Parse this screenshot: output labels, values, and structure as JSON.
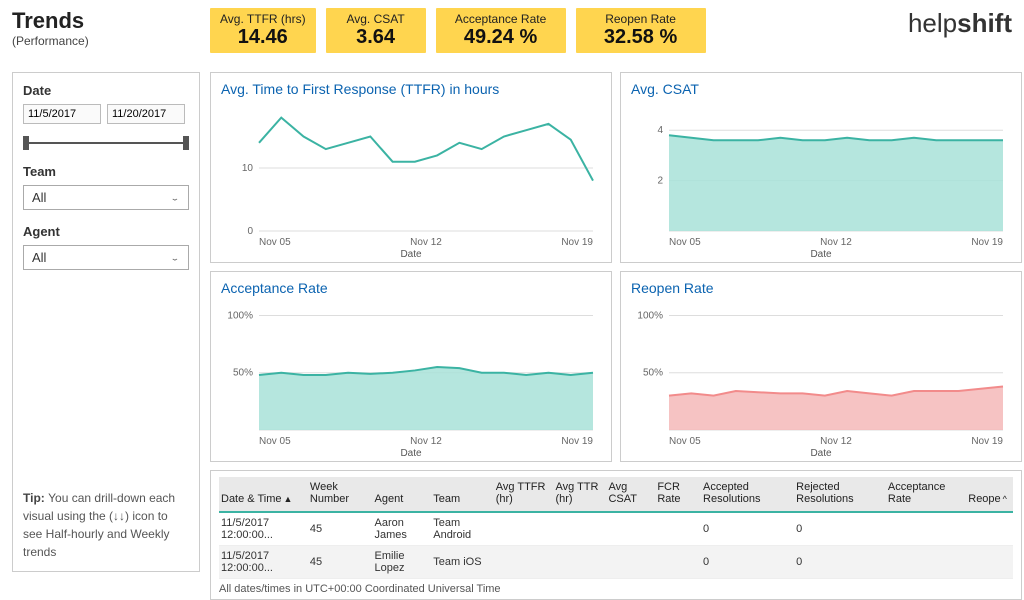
{
  "header": {
    "title": "Trends",
    "subtitle": "(Performance)",
    "brand_a": "help",
    "brand_b": "shift"
  },
  "kpis": [
    {
      "label": "Avg. TTFR (hrs)",
      "value": "14.46"
    },
    {
      "label": "Avg. CSAT",
      "value": "3.64"
    },
    {
      "label": "Acceptance Rate",
      "value": "49.24 %"
    },
    {
      "label": "Reopen Rate",
      "value": "32.58 %"
    }
  ],
  "sidebar": {
    "date_label": "Date",
    "date_from": "11/5/2017",
    "date_to": "11/20/2017",
    "team_label": "Team",
    "team_value": "All",
    "agent_label": "Agent",
    "agent_value": "All",
    "tip_label": "Tip:",
    "tip_text": "You can drill-down each visual using the (↓↓) icon to see Half-hourly and Weekly trends"
  },
  "chart_titles": {
    "ttfr": "Avg. Time to First Response (TTFR) in hours",
    "csat": "Avg. CSAT",
    "acc": "Acceptance Rate",
    "reopen": "Reopen Rate",
    "xaxis": "Date"
  },
  "xticks": {
    "first": "Nov 05",
    "mid": "Nov 12",
    "last": "Nov 19"
  },
  "chart_data": [
    {
      "id": "ttfr",
      "type": "line",
      "title": "Avg. Time to First Response (TTFR) in hours",
      "xlabel": "Date",
      "ylabel": "",
      "ylim": [
        0,
        20
      ],
      "yticks": [
        0,
        10
      ],
      "categories": [
        "Nov 05",
        "Nov 06",
        "Nov 07",
        "Nov 08",
        "Nov 09",
        "Nov 10",
        "Nov 11",
        "Nov 12",
        "Nov 13",
        "Nov 14",
        "Nov 15",
        "Nov 16",
        "Nov 17",
        "Nov 18",
        "Nov 19",
        "Nov 20"
      ],
      "values": [
        14,
        18,
        15,
        13,
        14,
        15,
        11,
        11,
        12,
        14,
        13,
        15,
        16,
        17,
        14.5,
        8
      ],
      "color": "#3bb3a3",
      "fill": false
    },
    {
      "id": "csat",
      "type": "area",
      "title": "Avg. CSAT",
      "xlabel": "Date",
      "ylabel": "",
      "ylim": [
        0,
        5
      ],
      "yticks": [
        2,
        4
      ],
      "categories": [
        "Nov 05",
        "Nov 06",
        "Nov 07",
        "Nov 08",
        "Nov 09",
        "Nov 10",
        "Nov 11",
        "Nov 12",
        "Nov 13",
        "Nov 14",
        "Nov 15",
        "Nov 16",
        "Nov 17",
        "Nov 18",
        "Nov 19",
        "Nov 20"
      ],
      "values": [
        3.8,
        3.7,
        3.6,
        3.6,
        3.6,
        3.7,
        3.6,
        3.6,
        3.7,
        3.6,
        3.6,
        3.7,
        3.6,
        3.6,
        3.6,
        3.6
      ],
      "color": "#3bb3a3",
      "fill": true,
      "fill_color": "#a8e2d8"
    },
    {
      "id": "acc",
      "type": "area",
      "title": "Acceptance Rate",
      "xlabel": "Date",
      "ylabel": "",
      "ylim": [
        0,
        110
      ],
      "yticks_pct": [
        50,
        100
      ],
      "categories": [
        "Nov 05",
        "Nov 06",
        "Nov 07",
        "Nov 08",
        "Nov 09",
        "Nov 10",
        "Nov 11",
        "Nov 12",
        "Nov 13",
        "Nov 14",
        "Nov 15",
        "Nov 16",
        "Nov 17",
        "Nov 18",
        "Nov 19",
        "Nov 20"
      ],
      "values": [
        48,
        50,
        48,
        48,
        50,
        49,
        50,
        52,
        55,
        54,
        50,
        50,
        48,
        50,
        48,
        50
      ],
      "unit": "%",
      "color": "#3bb3a3",
      "fill": true,
      "fill_color": "#a8e2d8"
    },
    {
      "id": "reopen",
      "type": "area",
      "title": "Reopen Rate",
      "xlabel": "Date",
      "ylabel": "",
      "ylim": [
        0,
        110
      ],
      "yticks_pct": [
        50,
        100
      ],
      "categories": [
        "Nov 05",
        "Nov 06",
        "Nov 07",
        "Nov 08",
        "Nov 09",
        "Nov 10",
        "Nov 11",
        "Nov 12",
        "Nov 13",
        "Nov 14",
        "Nov 15",
        "Nov 16",
        "Nov 17",
        "Nov 18",
        "Nov 19",
        "Nov 20"
      ],
      "values": [
        30,
        32,
        30,
        34,
        33,
        32,
        32,
        30,
        34,
        32,
        30,
        34,
        34,
        34,
        36,
        38
      ],
      "unit": "%",
      "color": "#f28b8b",
      "fill": true,
      "fill_color": "#f4b8b8"
    }
  ],
  "table": {
    "columns": [
      "Date & Time",
      "Week Number",
      "Agent",
      "Team",
      "Avg TTFR (hr)",
      "Avg TTR (hr)",
      "Avg CSAT",
      "FCR Rate",
      "Accepted Resolutions",
      "Rejected Resolutions",
      "Acceptance Rate",
      "Reopen Rate"
    ],
    "last_col_display": "Reope",
    "rows": [
      {
        "datetime": "11/5/2017 12:00:00...",
        "week": "45",
        "agent": "Aaron James",
        "team": "Team Android",
        "avg_ttfr": "",
        "avg_ttr": "",
        "avg_csat": "",
        "fcr": "",
        "accepted": "0",
        "rejected": "0",
        "acc_rate": "",
        "reopen": ""
      },
      {
        "datetime": "11/5/2017 12:00:00...",
        "week": "45",
        "agent": "Emilie Lopez",
        "team": "Team iOS",
        "avg_ttfr": "",
        "avg_ttr": "",
        "avg_csat": "",
        "fcr": "",
        "accepted": "0",
        "rejected": "0",
        "acc_rate": "",
        "reopen": ""
      }
    ],
    "tz_note": "All dates/times in UTC+00:00 Coordinated Universal Time"
  }
}
